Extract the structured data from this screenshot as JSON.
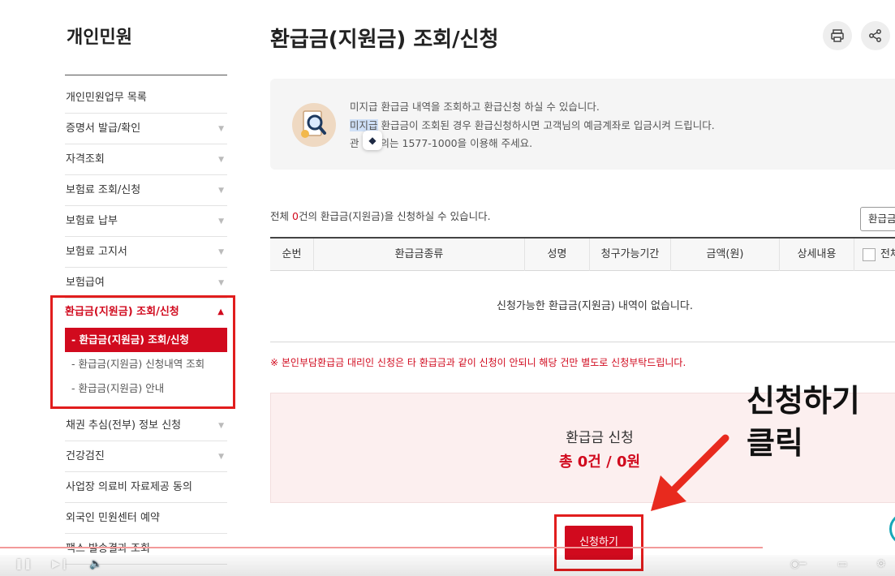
{
  "sidebar": {
    "title": "개인민원",
    "items_top": [
      {
        "label": "개인민원업무 목록",
        "arrow": ""
      },
      {
        "label": "증명서 발급/확인",
        "arrow": "▼"
      },
      {
        "label": "자격조회",
        "arrow": "▼"
      },
      {
        "label": "보험료 조회/신청",
        "arrow": "▼"
      },
      {
        "label": "보험료 납부",
        "arrow": "▼"
      },
      {
        "label": "보험료 고지서",
        "arrow": "▼"
      },
      {
        "label": "보험급여",
        "arrow": "▼"
      }
    ],
    "active_section": {
      "label": "환급금(지원금) 조회/신청",
      "arrow": "▲"
    },
    "sub_items": [
      {
        "label": "- 환급금(지원금) 조회/신청"
      },
      {
        "label": "- 환급금(지원금) 신청내역 조회"
      },
      {
        "label": "- 환급금(지원금) 안내"
      }
    ],
    "items_bottom": [
      {
        "label": "채권 추심(전부) 정보 신청",
        "arrow": "▼"
      },
      {
        "label": "건강검진",
        "arrow": "▼"
      },
      {
        "label": "사업장 의료비 자료제공 동의",
        "arrow": ""
      },
      {
        "label": "외국인 민원센터 예약",
        "arrow": ""
      },
      {
        "label": "팩스 발송결과 조회",
        "arrow": ""
      }
    ]
  },
  "header": {
    "title": "환급금(지원금) 조회/신청",
    "print_icon": "🖶",
    "share_icon": "⟨"
  },
  "info": {
    "line1": "미지급 환급금 내역을 조회하고 환급신청 하실 수 있습니다.",
    "line2_highlight": "미지급",
    "line2_rest": " 환급금이 조회된 경우 환급신청하시면 고객님의 예금계좌로 입금시켜 드립니다.",
    "line3_pre": "관",
    "line3_post": "의는 1577-1000을 이용해 주세요."
  },
  "count": {
    "prefix": "전체 ",
    "number": "0",
    "suffix": "건의 환급금(지원금)을 신청하실 수 있습니다.",
    "right_button": "환급금"
  },
  "table": {
    "headers": [
      "순번",
      "환급금종류",
      "성명",
      "청구가능기간",
      "금액(원)",
      "상세내용"
    ],
    "check_all_label": "전체",
    "empty_message": "신청가능한 환급금(지원금) 내역이 없습니다."
  },
  "notice": "※ 본인부담환급금 대리인 신청은 타 환급금과 같이 신청이 안되니 해당 건만 별도로 신청부탁드립니다.",
  "summary": {
    "label": "환급금 신청",
    "value": "총 0건 / 0원"
  },
  "apply_button": "신청하기",
  "annotation": {
    "line1": "신청하기",
    "line2": "클릭"
  },
  "colors": {
    "accent": "#d10a1e",
    "highlight_box": "#e11d1d",
    "summary_bg": "#fcefef"
  }
}
